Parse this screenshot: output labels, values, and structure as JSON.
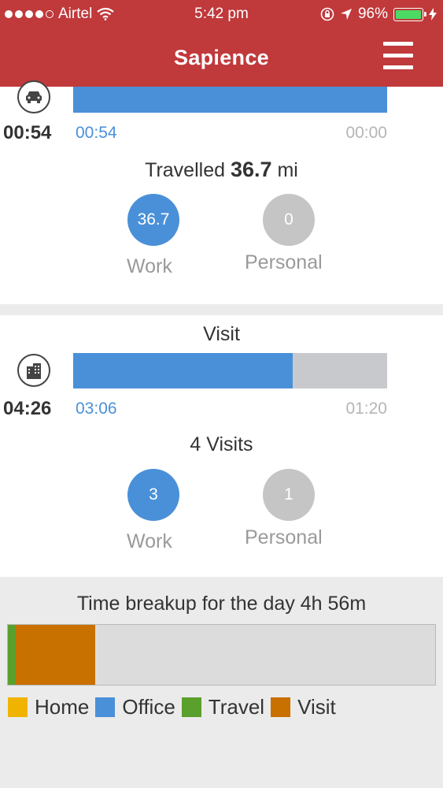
{
  "status_bar": {
    "carrier": "Airtel",
    "time": "5:42 pm",
    "battery": "96%",
    "battery_color": "#4cd964"
  },
  "header": {
    "title": "Sapience",
    "menu_icon": "hamburger-menu-icon",
    "background_color": "#c0393b"
  },
  "travel": {
    "icon": "car-icon",
    "total": "00:54",
    "work_time": "00:54",
    "personal_time": "00:00",
    "work_fraction": 1.0,
    "summary_prefix": "Travelled",
    "summary_value": "36.7",
    "summary_unit": "mi",
    "work_value": "36.7",
    "work_label": "Work",
    "personal_value": "0",
    "personal_label": "Personal"
  },
  "visit": {
    "title": "Visit",
    "icon": "building-icon",
    "total": "04:26",
    "work_time": "03:06",
    "personal_time": "01:20",
    "work_fraction": 0.7,
    "summary": "4 Visits",
    "work_value": "3",
    "work_label": "Work",
    "personal_value": "1",
    "personal_label": "Personal"
  },
  "breakup": {
    "title": "Time breakup for the day 4h 56m",
    "segments": [
      {
        "name": "Travel",
        "fraction": 0.018,
        "color": "#5aa02c"
      },
      {
        "name": "Visit",
        "fraction": 0.187,
        "color": "#c87000"
      }
    ],
    "legend": [
      {
        "label": "Home",
        "color": "#f0b400"
      },
      {
        "label": "Office",
        "color": "#4a90d9"
      },
      {
        "label": "Travel",
        "color": "#5aa02c"
      },
      {
        "label": "Visit",
        "color": "#c87000"
      }
    ]
  }
}
